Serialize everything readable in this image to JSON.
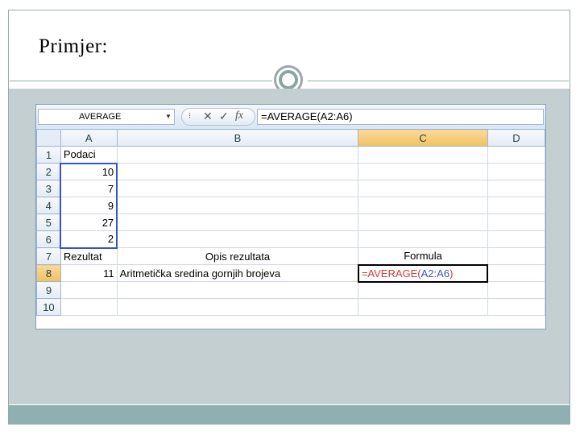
{
  "slide": {
    "title": "Primjer:"
  },
  "excel": {
    "name_box": "AVERAGE",
    "formula_bar_value": "=AVERAGE(A2:A6)",
    "formula_icons": [
      "cancel-icon",
      "enter-icon",
      "function-icon"
    ],
    "icon_glyphs": {
      "cancel": "✕",
      "enter": "✓",
      "fx": "fx"
    },
    "column_headers": [
      "A",
      "B",
      "C",
      "D"
    ],
    "row_headers": [
      "1",
      "2",
      "3",
      "4",
      "5",
      "6",
      "7",
      "8",
      "9",
      "10"
    ],
    "cells": {
      "A1": "Podaci",
      "A2": "10",
      "A3": "7",
      "A4": "9",
      "A5": "27",
      "A6": "2",
      "A7": "Rezultat",
      "B7": "Opis rezultata",
      "C7": "Formula",
      "A8": "11",
      "B8": "Aritmetička sredina gornjih brojeva",
      "C8_fn": "=AVERAGE(",
      "C8_range": "A2:A6",
      "C8_close": ")"
    },
    "active_cell": "C8",
    "range_highlight_color": "#3755c4",
    "function_color": "#d83a34"
  }
}
